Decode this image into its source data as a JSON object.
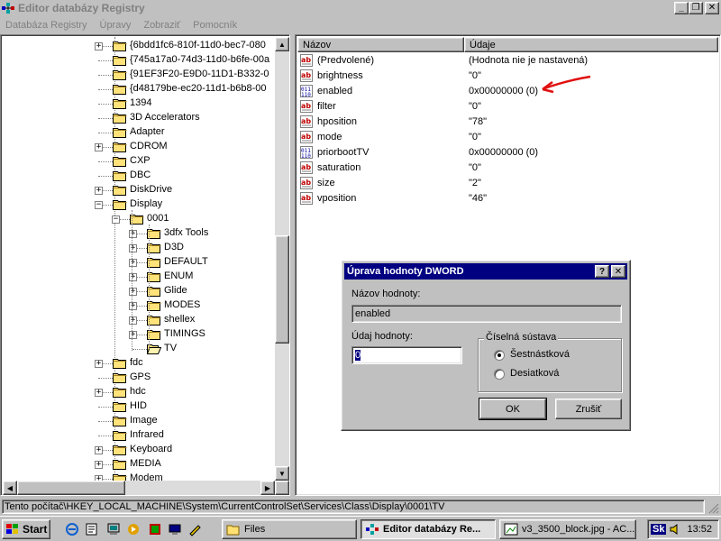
{
  "window": {
    "title": "Editor databázy Registry"
  },
  "menu": {
    "items": [
      "Databáza Registry",
      "Úpravy",
      "Zobraziť",
      "Pomocník"
    ]
  },
  "tree": {
    "nodes": [
      {
        "label": "{6bdd1fc6-810f-11d0-bec7-080",
        "level": 0,
        "expander": "plus"
      },
      {
        "label": "{745a17a0-74d3-11d0-b6fe-00a",
        "level": 0,
        "expander": "none"
      },
      {
        "label": "{91EF3F20-E9D0-11D1-B332-0",
        "level": 0,
        "expander": "none"
      },
      {
        "label": "{d48179be-ec20-11d1-b6b8-00",
        "level": 0,
        "expander": "none"
      },
      {
        "label": "1394",
        "level": 0,
        "expander": "none"
      },
      {
        "label": "3D Accelerators",
        "level": 0,
        "expander": "none"
      },
      {
        "label": "Adapter",
        "level": 0,
        "expander": "none"
      },
      {
        "label": "CDROM",
        "level": 0,
        "expander": "plus"
      },
      {
        "label": "CXP",
        "level": 0,
        "expander": "none"
      },
      {
        "label": "DBC",
        "level": 0,
        "expander": "none"
      },
      {
        "label": "DiskDrive",
        "level": 0,
        "expander": "plus"
      },
      {
        "label": "Display",
        "level": 0,
        "expander": "minus"
      },
      {
        "label": "0001",
        "level": 1,
        "expander": "minus"
      },
      {
        "label": "3dfx Tools",
        "level": 2,
        "expander": "plus"
      },
      {
        "label": "D3D",
        "level": 2,
        "expander": "plus"
      },
      {
        "label": "DEFAULT",
        "level": 2,
        "expander": "plus"
      },
      {
        "label": "ENUM",
        "level": 2,
        "expander": "plus"
      },
      {
        "label": "Glide",
        "level": 2,
        "expander": "plus"
      },
      {
        "label": "MODES",
        "level": 2,
        "expander": "plus"
      },
      {
        "label": "shellex",
        "level": 2,
        "expander": "plus"
      },
      {
        "label": "TIMINGS",
        "level": 2,
        "expander": "plus"
      },
      {
        "label": "TV",
        "level": 2,
        "expander": "none",
        "open": true
      },
      {
        "label": "fdc",
        "level": 0,
        "expander": "plus"
      },
      {
        "label": "GPS",
        "level": 0,
        "expander": "none"
      },
      {
        "label": "hdc",
        "level": 0,
        "expander": "plus"
      },
      {
        "label": "HID",
        "level": 0,
        "expander": "none"
      },
      {
        "label": "Image",
        "level": 0,
        "expander": "none"
      },
      {
        "label": "Infrared",
        "level": 0,
        "expander": "none"
      },
      {
        "label": "Keyboard",
        "level": 0,
        "expander": "plus"
      },
      {
        "label": "MEDIA",
        "level": 0,
        "expander": "plus"
      },
      {
        "label": "Modem",
        "level": 0,
        "expander": "plus"
      }
    ]
  },
  "list": {
    "columns": [
      "Názov",
      "Údaje"
    ],
    "rows": [
      {
        "icon": "string-value-icon",
        "name": "(Predvolené)",
        "data": "(Hodnota nie je nastavená)"
      },
      {
        "icon": "string-value-icon",
        "name": "brightness",
        "data": "\"0\""
      },
      {
        "icon": "dword-value-icon",
        "name": "enabled",
        "data": "0x00000000 (0)"
      },
      {
        "icon": "string-value-icon",
        "name": "filter",
        "data": "\"0\""
      },
      {
        "icon": "string-value-icon",
        "name": "hposition",
        "data": "\"78\""
      },
      {
        "icon": "string-value-icon",
        "name": "mode",
        "data": "\"0\""
      },
      {
        "icon": "dword-value-icon",
        "name": "priorbootTV",
        "data": "0x00000000 (0)"
      },
      {
        "icon": "string-value-icon",
        "name": "saturation",
        "data": "\"0\""
      },
      {
        "icon": "string-value-icon",
        "name": "size",
        "data": "\"2\""
      },
      {
        "icon": "string-value-icon",
        "name": "vposition",
        "data": "\"46\""
      }
    ]
  },
  "dialog": {
    "title": "Úprava hodnoty DWORD",
    "help_button": "?",
    "close_button": "✕",
    "name_label": "Názov hodnoty:",
    "name_value": "enabled",
    "data_label": "Údaj hodnoty:",
    "data_value": "0",
    "base_group_label": "Číselná sústava",
    "base_options": [
      {
        "label": "Šestnástková",
        "checked": true
      },
      {
        "label": "Desiatková",
        "checked": false
      }
    ],
    "ok_label": "OK",
    "cancel_label": "Zrušiť"
  },
  "status": {
    "path": "Tento počítač\\HKEY_LOCAL_MACHINE\\System\\CurrentControlSet\\Services\\Class\\Display\\0001\\TV"
  },
  "taskbar": {
    "start_label": "Start",
    "tasks": [
      {
        "label": "Files",
        "active": false
      },
      {
        "label": "Editor databázy Re...",
        "active": true
      },
      {
        "label": "v3_3500_block.jpg - AC...",
        "active": false
      }
    ],
    "keyboard_indicator": "Sk",
    "clock": "13:52"
  },
  "colors": {
    "accent": "#000080",
    "annotation": "#e01010"
  }
}
